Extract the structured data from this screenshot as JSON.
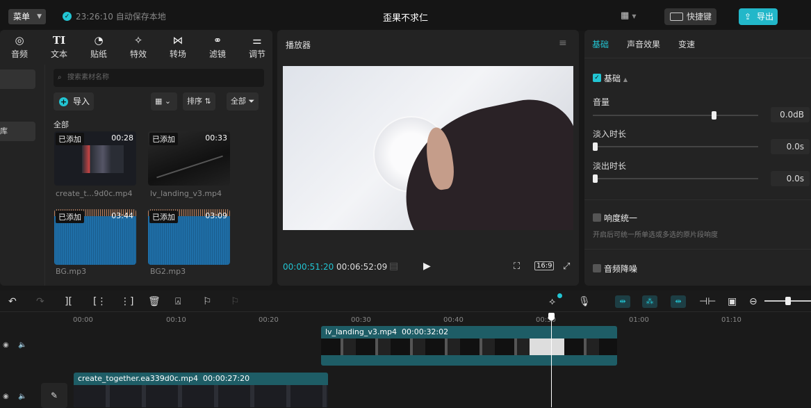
{
  "topbar": {
    "menu_label": "菜单",
    "save_status": "23:26:10 自动保存本地",
    "title": "歪果不求仁",
    "shortcut_label": "快捷键",
    "export_label": "导出"
  },
  "tools": [
    {
      "label": "音频",
      "icon": "audio-icon"
    },
    {
      "label": "文本",
      "icon": "text-icon"
    },
    {
      "label": "贴纸",
      "icon": "sticker-icon"
    },
    {
      "label": "特效",
      "icon": "effects-icon"
    },
    {
      "label": "转场",
      "icon": "transition-icon"
    },
    {
      "label": "滤镜",
      "icon": "filter-icon"
    },
    {
      "label": "调节",
      "icon": "adjust-icon"
    }
  ],
  "sidebar": {
    "partial_label": "库"
  },
  "media": {
    "search_placeholder": "搜索素材名称",
    "import_label": "导入",
    "sort_label": "排序",
    "filter_label": "全部",
    "category_label": "全部",
    "items": [
      {
        "badge": "已添加",
        "duration": "00:28",
        "name": "create_t...9d0c.mp4"
      },
      {
        "badge": "已添加",
        "duration": "00:33",
        "name": "lv_landing_v3.mp4"
      },
      {
        "badge": "已添加",
        "duration": "03:44",
        "name": "BG.mp3"
      },
      {
        "badge": "已添加",
        "duration": "03:09",
        "name": "BG2.mp3"
      }
    ]
  },
  "player": {
    "title": "播放器",
    "current_time": "00:00:51:20",
    "total_time": "00:06:52:09",
    "ratio_label": "16:9"
  },
  "inspector": {
    "tabs": [
      "基础",
      "声音效果",
      "变速"
    ],
    "section_basic": "基础",
    "volume_label": "音量",
    "volume_value": "0.0dB",
    "volume_level": 0.73,
    "fadein_label": "淡入时长",
    "fadein_value": "0.0s",
    "fadeout_label": "淡出时长",
    "fadeout_value": "0.0s",
    "loudness_label": "响度统一",
    "loudness_desc": "开启后可统一所单选或多选的原片段响度",
    "denoise_label": "音频降噪"
  },
  "timeline": {
    "ruler": [
      "00:00",
      "00:10",
      "00:20",
      "00:30",
      "00:40",
      "00:50",
      "01:00",
      "01:10"
    ],
    "clip1": {
      "name": "lv_landing_v3.mp4",
      "duration": "00:00:32:02"
    },
    "clip2": {
      "name": "create_together.ea339d0c.mp4",
      "duration": "00:00:27:20"
    }
  },
  "colors": {
    "accent": "#22c5d3",
    "clip_teal": "#1e5d66",
    "audio_blue": "#1f6fa8"
  }
}
